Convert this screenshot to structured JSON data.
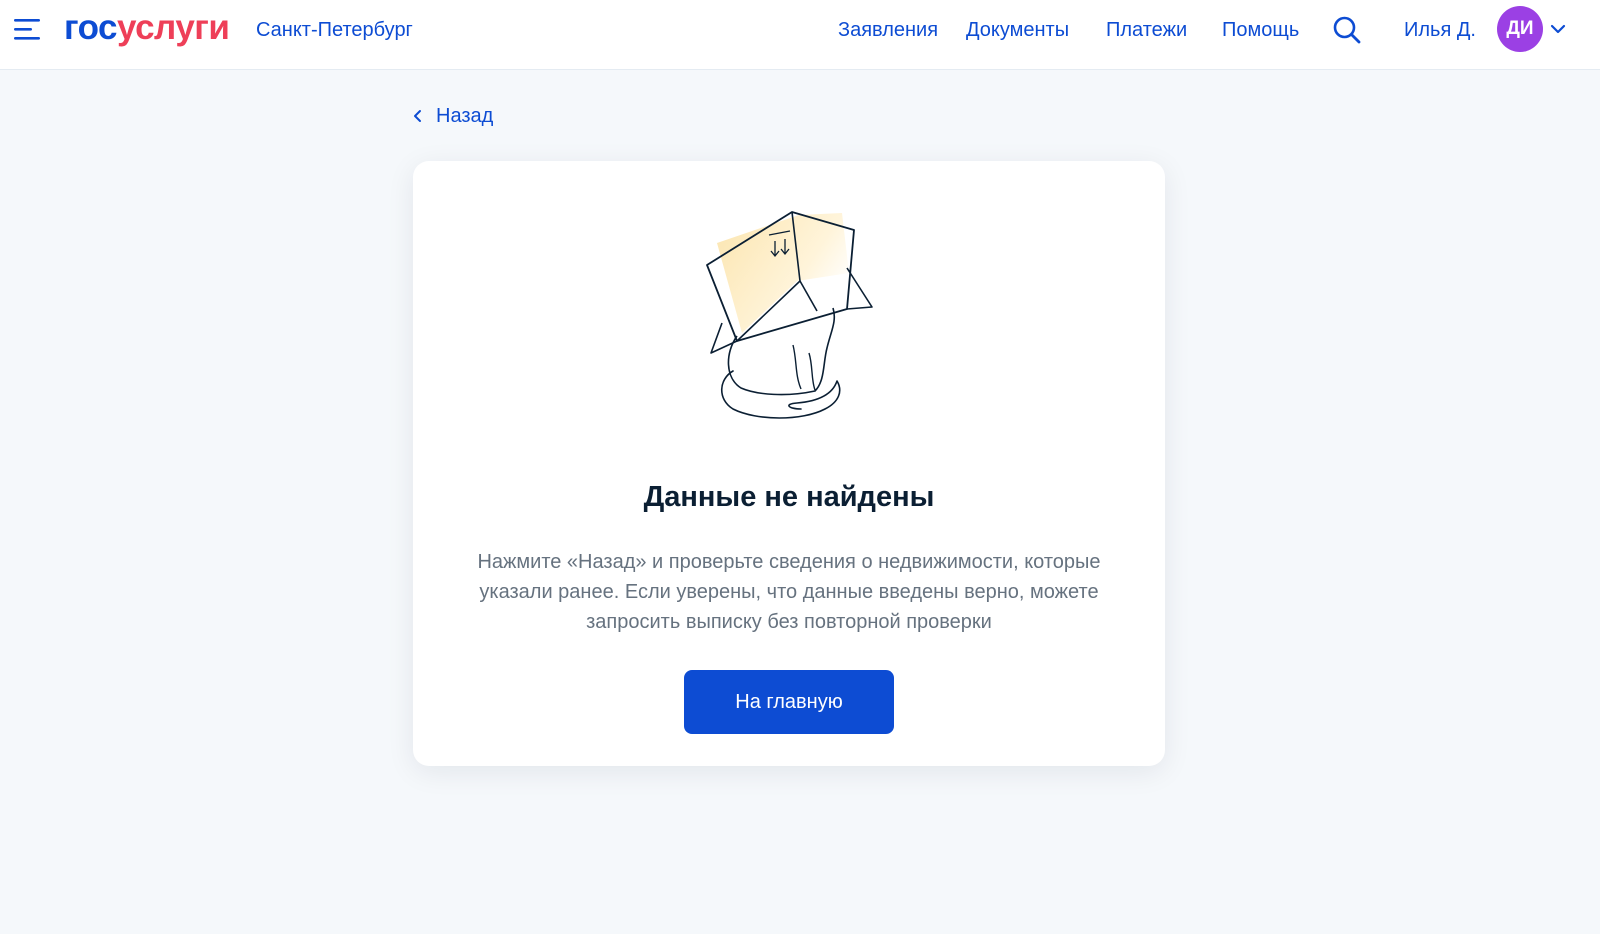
{
  "header": {
    "menu_icon": "burger-menu-icon",
    "logo_part1": "гос",
    "logo_part2": "услуги",
    "region": "Санкт-Петербург",
    "nav": [
      "Заявления",
      "Документы",
      "Платежи",
      "Помощь"
    ],
    "search_icon": "search-icon",
    "user_name": "Илья Д.",
    "avatar_initials": "ДИ",
    "user_menu_icon": "chevron-down-icon"
  },
  "back": {
    "label": "Назад",
    "icon": "chevron-left-icon"
  },
  "result": {
    "illustration": "cat-in-box-illustration",
    "title": "Данные не найдены",
    "description": "Нажмите «Назад» и проверьте сведения о недвижимости, которые указали ранее. Если уверены, что данные введены верно, можете запросить выписку без повторной проверки",
    "button_label": "На главную"
  },
  "colors": {
    "brand_blue": "#0d4cd3",
    "brand_red": "#ee3f58",
    "avatar_purple": "#9b40e4",
    "page_bg": "#f5f8fb",
    "text_primary": "#0b1f33",
    "text_secondary": "#66727f"
  }
}
